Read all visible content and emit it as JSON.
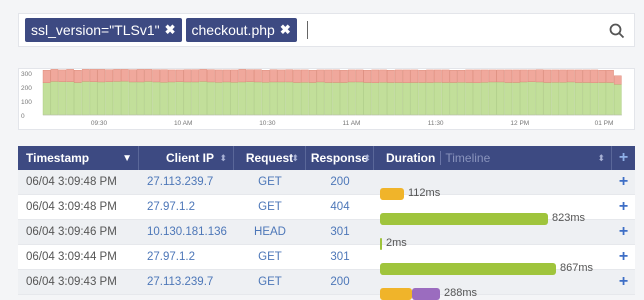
{
  "search": {
    "chips": [
      {
        "label": "ssl_version=\"TLSv1\"",
        "remove": "✖"
      },
      {
        "label": "checkout.php",
        "remove": "✖"
      }
    ],
    "icon": "search-icon"
  },
  "chart_data": {
    "type": "bar",
    "stacked": true,
    "ylim": [
      0,
      300
    ],
    "yticks": [
      "300",
      "200",
      "100",
      "0"
    ],
    "xticks": [
      "09:30",
      "10 AM",
      "10:30",
      "11 AM",
      "11:30",
      "12 PM",
      "01 PM"
    ],
    "series": [
      {
        "color": "#c2df9a",
        "values": [
          230,
          240,
          238,
          238,
          232,
          240,
          238,
          236,
          238,
          240,
          242,
          236,
          236,
          240,
          236,
          234,
          236,
          238,
          236,
          236,
          240,
          236,
          234,
          236,
          234,
          236,
          238,
          236,
          234,
          236,
          236,
          236,
          232,
          234,
          232,
          236,
          232,
          232,
          232,
          236,
          236,
          232,
          230,
          234,
          232,
          232,
          230,
          232,
          232,
          232,
          234,
          232,
          232,
          234,
          232,
          230,
          234,
          236,
          236,
          232,
          232,
          236,
          238,
          236,
          232,
          234,
          234,
          236,
          232,
          232,
          230,
          232,
          232,
          220
        ]
      },
      {
        "color": "#f0a89c",
        "values": [
          90,
          86,
          84,
          88,
          88,
          86,
          88,
          90,
          86,
          86,
          84,
          88,
          90,
          86,
          88,
          90,
          86,
          84,
          88,
          88,
          86,
          88,
          88,
          86,
          88,
          90,
          86,
          88,
          86,
          88,
          86,
          88,
          90,
          88,
          88,
          86,
          90,
          90,
          88,
          86,
          86,
          88,
          92,
          88,
          88,
          90,
          92,
          90,
          88,
          90,
          88,
          90,
          88,
          86,
          90,
          92,
          88,
          86,
          86,
          90,
          90,
          86,
          84,
          88,
          90,
          88,
          88,
          86,
          90,
          90,
          92,
          88,
          88,
          60
        ]
      }
    ]
  },
  "table": {
    "columns": {
      "timestamp": "Timestamp",
      "client_ip": "Client IP",
      "request": "Request",
      "response": "Response",
      "duration": "Duration",
      "timeline": "Timeline"
    },
    "rows": [
      {
        "ts": "06/04 3:09:48 PM",
        "ip": "27.113.239.7",
        "req": "GET",
        "resp": "200",
        "dur": "112ms",
        "segments": [
          {
            "frac": 0.12,
            "color": "#f0b42a"
          }
        ]
      },
      {
        "ts": "06/04 3:09:48 PM",
        "ip": "27.97.1.2",
        "req": "GET",
        "resp": "404",
        "dur": "823ms",
        "segments": [
          {
            "frac": 0.84,
            "color": "#9fc43c"
          }
        ]
      },
      {
        "ts": "06/04 3:09:46 PM",
        "ip": "10.130.181.136",
        "req": "HEAD",
        "resp": "301",
        "dur": "2ms",
        "segments": [
          {
            "frac": 0.005,
            "color": "#9fc43c"
          }
        ]
      },
      {
        "ts": "06/04 3:09:44 PM",
        "ip": "27.97.1.2",
        "req": "GET",
        "resp": "301",
        "dur": "867ms",
        "segments": [
          {
            "frac": 0.88,
            "color": "#9fc43c"
          }
        ]
      },
      {
        "ts": "06/04 3:09:43 PM",
        "ip": "27.113.239.7",
        "req": "GET",
        "resp": "200",
        "dur": "288ms",
        "segments": [
          {
            "frac": 0.16,
            "color": "#f0b42a"
          },
          {
            "frac": 0.14,
            "color": "#9b6cbf"
          }
        ]
      }
    ],
    "add_glyph": "+"
  },
  "colors": {
    "header_bg": "#3d4a82",
    "link": "#4d77b8",
    "green_bar": "#9fc43c",
    "orange_bar": "#f0b42a",
    "purple_bar": "#9b6cbf"
  }
}
